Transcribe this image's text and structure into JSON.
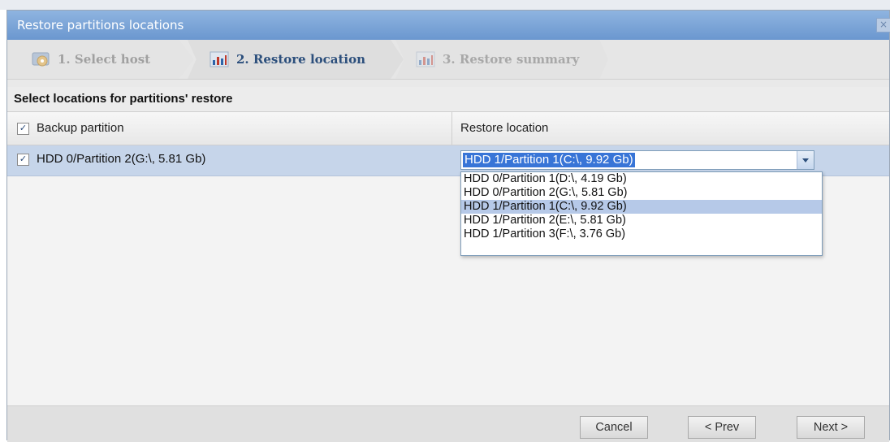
{
  "window": {
    "title": "Restore partitions locations",
    "close_icon": "close-icon"
  },
  "wizard": {
    "steps": [
      {
        "label": "1. Select host",
        "icon": "host-disk-icon",
        "state": "done"
      },
      {
        "label": "2. Restore location",
        "icon": "chart-icon",
        "state": "active"
      },
      {
        "label": "3. Restore summary",
        "icon": "chart-icon",
        "state": "pending"
      }
    ]
  },
  "section": {
    "title": "Select locations for partitions' restore"
  },
  "grid": {
    "columns": [
      "Backup partition",
      "Restore location"
    ],
    "header_checked": true,
    "rows": [
      {
        "checked": true,
        "backup_partition": "HDD 0/Partition 2(G:\\, 5.81 Gb)",
        "restore_location": "HDD 1/Partition 1(C:\\, 9.92 Gb)"
      }
    ]
  },
  "dropdown": {
    "options": [
      "HDD 0/Partition 1(D:\\, 4.19 Gb)",
      "HDD 0/Partition 2(G:\\, 5.81 Gb)",
      "HDD 1/Partition 1(C:\\, 9.92 Gb)",
      "HDD 1/Partition 2(E:\\, 5.81 Gb)",
      "HDD 1/Partition 3(F:\\, 3.76 Gb)"
    ],
    "selected_index": 2
  },
  "footer": {
    "cancel_label": "Cancel",
    "prev_label": "< Prev",
    "next_label": "Next >"
  },
  "colors": {
    "titlebar": "#7aa3d8",
    "selected_row": "#c6d5ea",
    "selection_highlight": "#3875d7",
    "active_step_text": "#2c4f7c"
  }
}
